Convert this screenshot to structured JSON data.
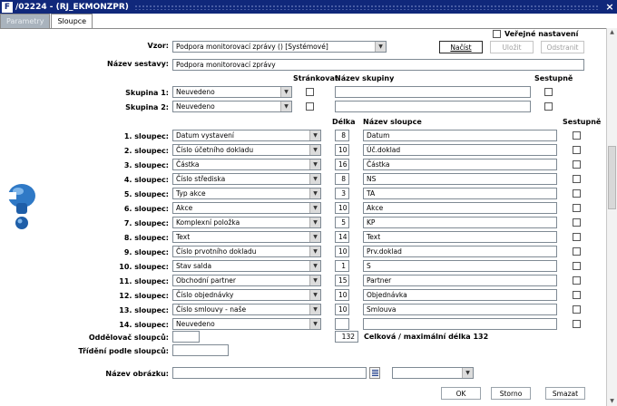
{
  "window": {
    "title": "/02224 - (RJ_EKMONZPR)",
    "close": "×"
  },
  "tabs": [
    {
      "label": "Parametry"
    },
    {
      "label": "Sloupce"
    }
  ],
  "vzor": {
    "label": "Vzor:",
    "value": "Podpora monitorovací zprávy   ()   [Systémové]"
  },
  "buttons": {
    "nacist": "Načíst",
    "ulozit": "Uložit",
    "odstranit": "Odstranit",
    "ok": "OK",
    "storno": "Storno",
    "smazat": "Smazat"
  },
  "verejne_label": "Veřejné nastavení",
  "nazev_sestavy": {
    "label": "Název sestavy:",
    "value": "Podpora monitorovací zprávy"
  },
  "group_headers": {
    "strankovat": "Stránkovat",
    "nazev_skupiny": "Název skupiny",
    "sestupne": "Sestupně"
  },
  "groups": [
    {
      "label": "Skupina 1:",
      "value": "Neuvedeno",
      "name": ""
    },
    {
      "label": "Skupina 2:",
      "value": "Neuvedeno",
      "name": ""
    }
  ],
  "column_headers": {
    "delka": "Délka",
    "nazev_sloupce": "Název sloupce",
    "sestupne": "Sestupně"
  },
  "columns": [
    {
      "label": "1. sloupec:",
      "value": "Datum vystavení",
      "length": "8",
      "name": "Datum"
    },
    {
      "label": "2. sloupec:",
      "value": "Číslo účetního dokladu",
      "length": "10",
      "name": "Úč.doklad"
    },
    {
      "label": "3. sloupec:",
      "value": "Částka",
      "length": "16",
      "name": "Částka"
    },
    {
      "label": "4. sloupec:",
      "value": "Číslo střediska",
      "length": "8",
      "name": "NS"
    },
    {
      "label": "5. sloupec:",
      "value": "Typ akce",
      "length": "3",
      "name": "TA"
    },
    {
      "label": "6. sloupec:",
      "value": "Akce",
      "length": "10",
      "name": "Akce"
    },
    {
      "label": "7. sloupec:",
      "value": "Komplexní položka",
      "length": "5",
      "name": "KP"
    },
    {
      "label": "8. sloupec:",
      "value": "Text",
      "length": "14",
      "name": "Text"
    },
    {
      "label": "9. sloupec:",
      "value": "Číslo prvotního dokladu",
      "length": "10",
      "name": "Prv.doklad"
    },
    {
      "label": "10. sloupec:",
      "value": "Stav salda",
      "length": "1",
      "name": "S"
    },
    {
      "label": "11. sloupec:",
      "value": "Obchodní partner",
      "length": "15",
      "name": "Partner"
    },
    {
      "label": "12. sloupec:",
      "value": "Číslo objednávky",
      "length": "10",
      "name": "Objednávka"
    },
    {
      "label": "13. sloupec:",
      "value": "Číslo smlouvy - naše",
      "length": "10",
      "name": "Smlouva"
    },
    {
      "label": "14. sloupec:",
      "value": "Neuvedeno",
      "length": "",
      "name": ""
    }
  ],
  "oddelovac_label": "Oddělovač sloupců:",
  "trideni_label": "Třídění podle sloupců:",
  "total": {
    "value": "132",
    "label": "Celková / maximální délka 132"
  },
  "nazev_obrazku_label": "Název obrázku:"
}
